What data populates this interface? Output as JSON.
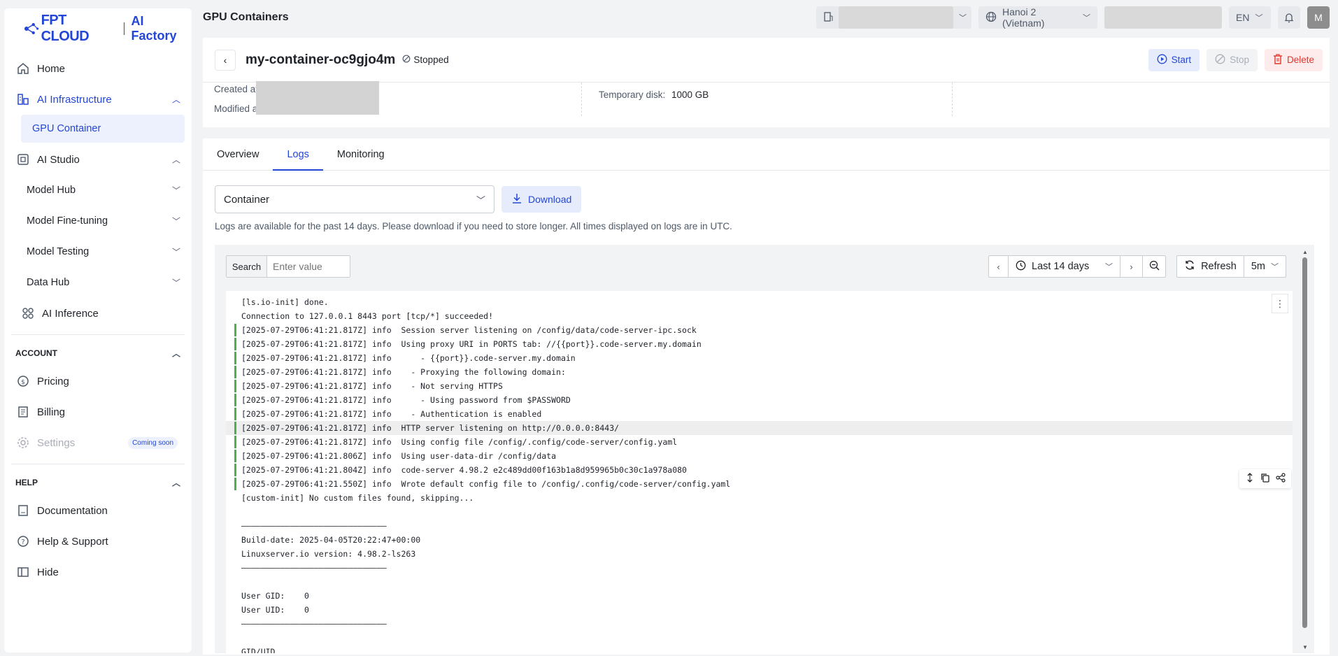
{
  "brand": {
    "logo_text": "FPT CLOUD",
    "product": "AI Factory"
  },
  "sidebar": {
    "home": "Home",
    "ai_infrastructure": "AI Infrastructure",
    "gpu_container": "GPU Container",
    "ai_studio": "AI Studio",
    "model_hub": "Model Hub",
    "model_fine_tuning": "Model Fine-tuning",
    "model_testing": "Model Testing",
    "data_hub": "Data Hub",
    "ai_inference": "AI Inference",
    "account_section": "ACCOUNT",
    "pricing": "Pricing",
    "billing": "Billing",
    "settings": "Settings",
    "coming_soon": "Coming soon",
    "help_section": "HELP",
    "documentation": "Documentation",
    "help_support": "Help & Support",
    "hide": "Hide"
  },
  "topbar": {
    "page_title": "GPU Containers",
    "region": "Hanoi 2 (Vietnam)",
    "language": "EN",
    "avatar_initial": "M"
  },
  "container": {
    "name": "my-container-oc9gjo4m",
    "status": "Stopped",
    "start": "Start",
    "stop": "Stop",
    "delete": "Delete"
  },
  "info": {
    "created_label": "Created at",
    "modified_label": "Modified at",
    "temp_disk_label": "Temporary disk:",
    "temp_disk_value": "1000 GB"
  },
  "tabs": [
    "Overview",
    "Logs",
    "Monitoring"
  ],
  "logs": {
    "source": "Container",
    "download": "Download",
    "note": "Logs are available for the past 14 days. Please download if you need to store longer. All times displayed on logs are in UTC.",
    "search_label": "Search",
    "search_placeholder": "Enter value",
    "time_range": "Last 14 days",
    "refresh": "Refresh",
    "interval": "5m",
    "lines": [
      "[ls.io-init] done.",
      "Connection to 127.0.0.1 8443 port [tcp/*] succeeded!",
      "[2025-07-29T06:41:21.817Z] info  Session server listening on /config/data/code-server-ipc.sock",
      "[2025-07-29T06:41:21.817Z] info  Using proxy URI in PORTS tab: //{{port}}.code-server.my.domain",
      "[2025-07-29T06:41:21.817Z] info      - {{port}}.code-server.my.domain",
      "[2025-07-29T06:41:21.817Z] info    - Proxying the following domain:",
      "[2025-07-29T06:41:21.817Z] info    - Not serving HTTPS",
      "[2025-07-29T06:41:21.817Z] info      - Using password from $PASSWORD",
      "[2025-07-29T06:41:21.817Z] info    - Authentication is enabled",
      "[2025-07-29T06:41:21.817Z] info  HTTP server listening on http://0.0.0.0:8443/",
      "[2025-07-29T06:41:21.817Z] info  Using config file /config/.config/code-server/config.yaml",
      "[2025-07-29T06:41:21.806Z] info  Using user-data-dir /config/data",
      "[2025-07-29T06:41:21.804Z] info  code-server 4.98.2 e2c489dd00f163b1a8d959965b0c30c1a978a080",
      "[2025-07-29T06:41:21.550Z] info  Wrote default config file to /config/.config/code-server/config.yaml",
      "[custom-init] No custom files found, skipping...",
      "",
      "——————————————————————————————",
      "Build-date: 2025-04-05T20:22:47+00:00",
      "Linuxserver.io version: 4.98.2-ls263",
      "——————————————————————————————",
      "",
      "User GID:    0",
      "User UID:    0",
      "——————————————————————————————",
      "",
      "GID/UID",
      "——————————————————————————————"
    ],
    "flagged_lines": [
      2,
      3,
      4,
      5,
      6,
      7,
      8,
      9,
      10,
      11,
      12,
      13
    ],
    "highlighted_line": 9
  },
  "colors": {
    "accent": "#2346d6",
    "danger": "#e5352b",
    "log_flag": "#4caf50"
  }
}
